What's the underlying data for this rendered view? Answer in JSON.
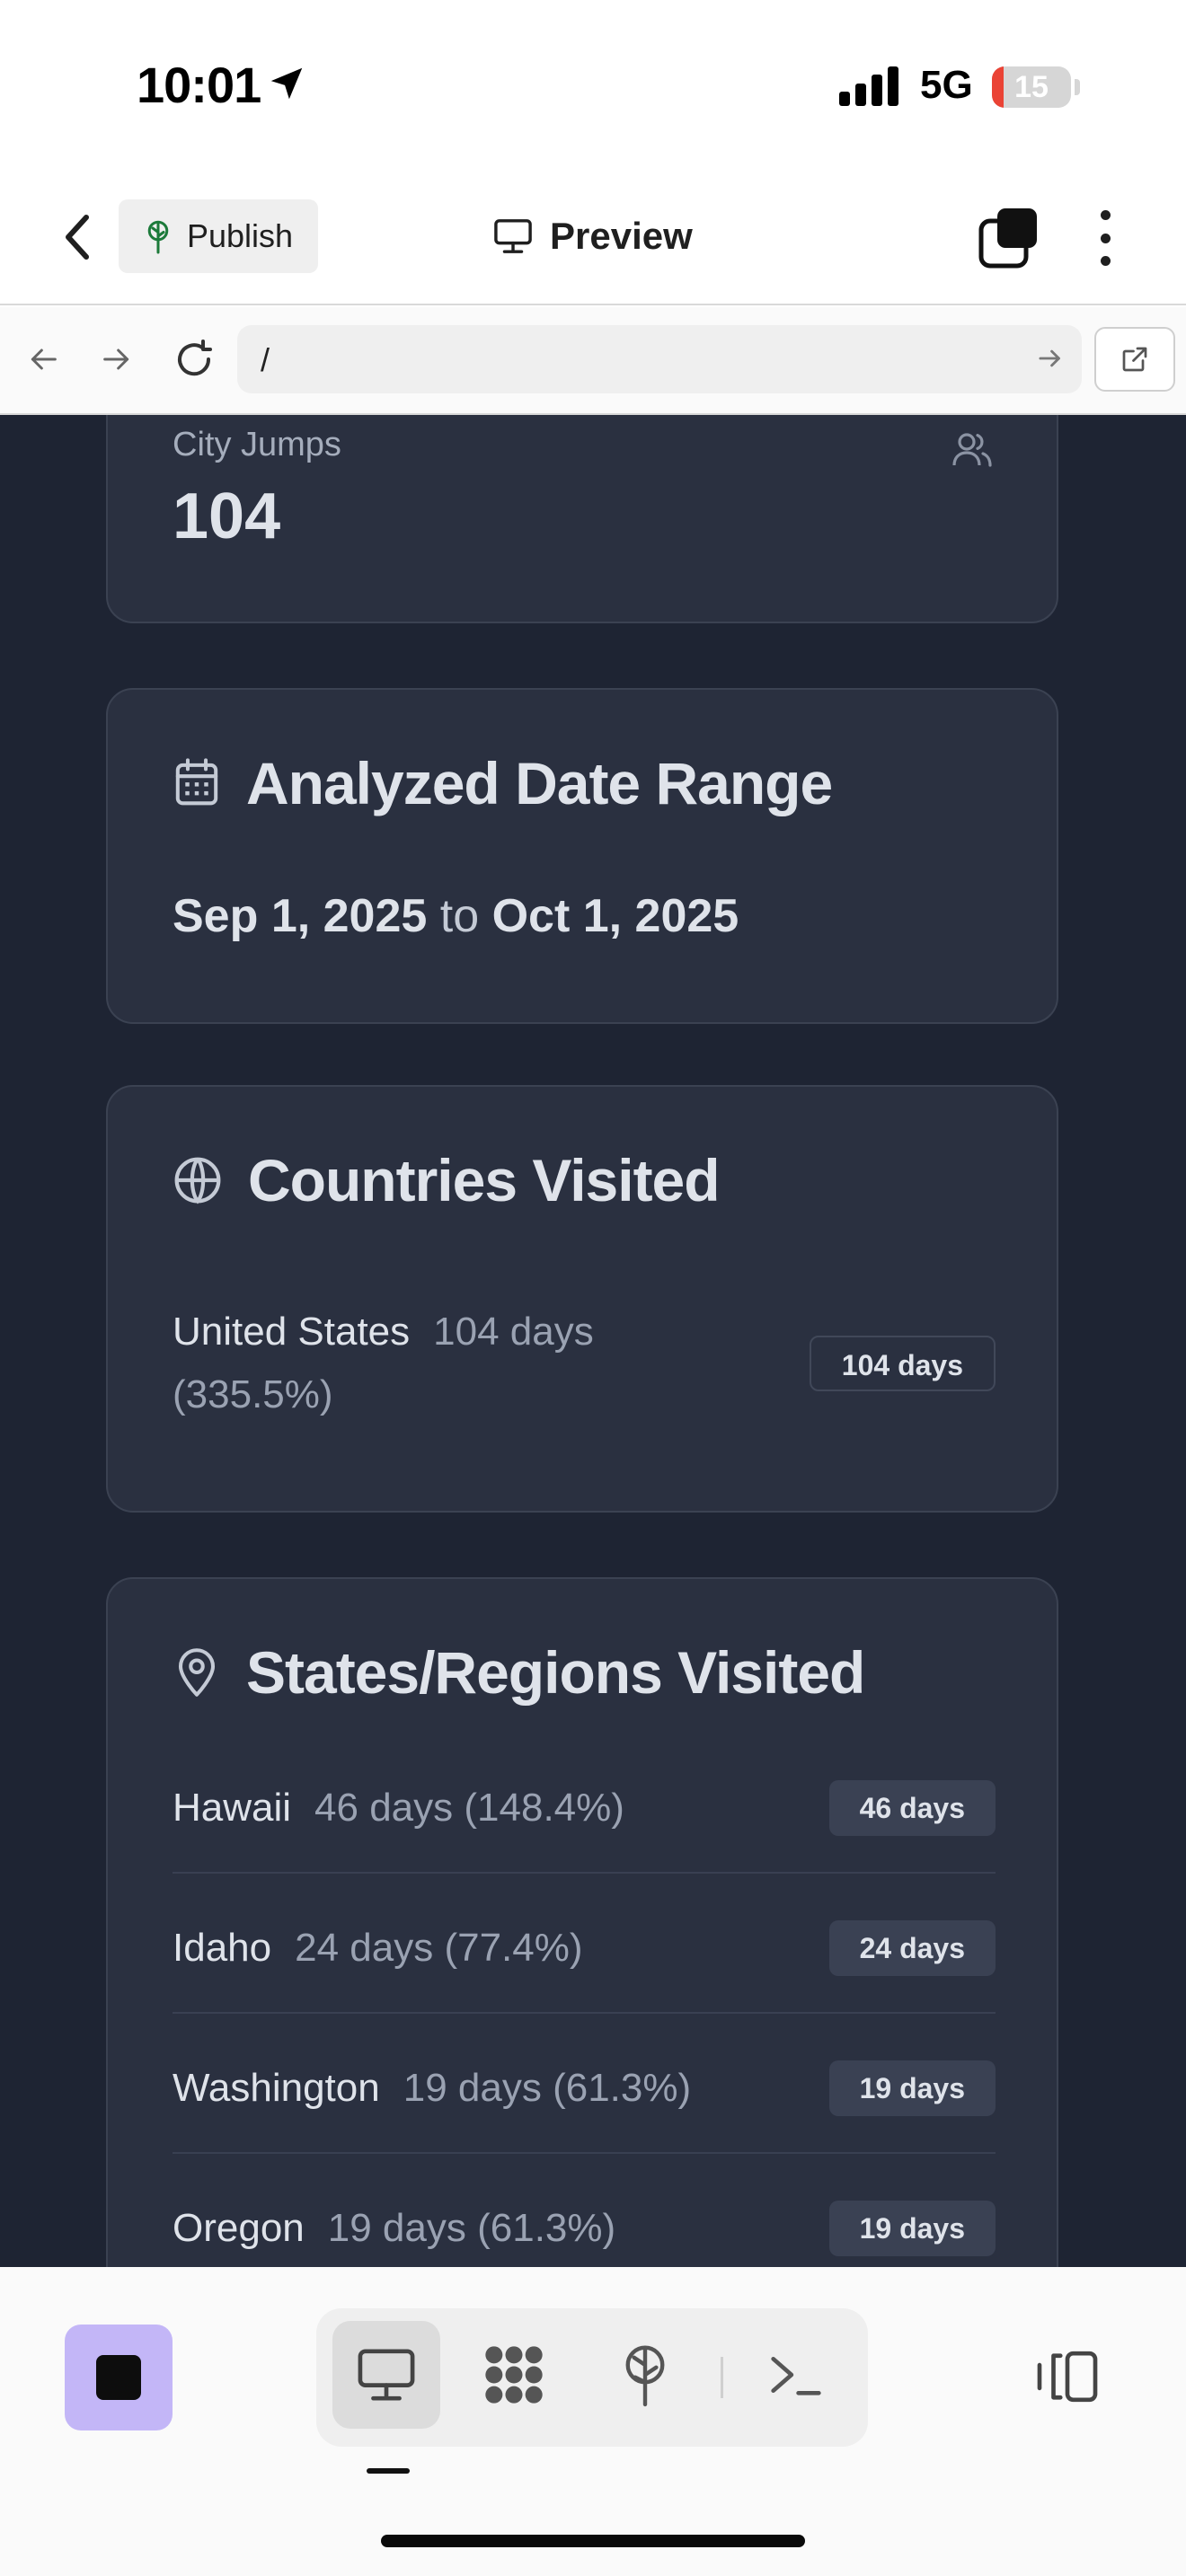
{
  "status_bar": {
    "time": "10:01",
    "network": "5G",
    "battery": "15",
    "battery_level_percent": 15
  },
  "header": {
    "publish_label": "Publish",
    "preview_label": "Preview"
  },
  "browser": {
    "url": "/"
  },
  "stats": {
    "city_jumps_label": "City Jumps",
    "city_jumps_value": "104"
  },
  "date_range": {
    "title": "Analyzed Date Range",
    "start": "Sep 1, 2025",
    "connector": "to",
    "end": "Oct 1, 2025"
  },
  "countries": {
    "title": "Countries Visited",
    "items": [
      {
        "name": "United States",
        "detail_days": "104 days",
        "detail_pct": "(335.5%)",
        "badge": "104 days"
      }
    ]
  },
  "states": {
    "title": "States/Regions Visited",
    "items": [
      {
        "name": "Hawaii",
        "detail": "46 days (148.4%)",
        "badge": "46 days"
      },
      {
        "name": "Idaho",
        "detail": "24 days (77.4%)",
        "badge": "24 days"
      },
      {
        "name": "Washington",
        "detail": "19 days (61.3%)",
        "badge": "19 days"
      },
      {
        "name": "Oregon",
        "detail": "19 days (61.3%)",
        "badge": "19 days"
      }
    ]
  },
  "icons": {
    "status": [
      "location-arrow-icon",
      "signal-icon"
    ],
    "header": [
      "chevron-left-icon",
      "tree-icon",
      "monitor-icon",
      "stack-icon",
      "more-vertical-icon"
    ],
    "browser": [
      "arrow-left-icon",
      "arrow-right-icon",
      "reload-icon",
      "external-link-icon"
    ],
    "cards": [
      "users-icon",
      "calendar-icon",
      "globe-icon",
      "map-pin-icon"
    ],
    "toolbar": [
      "stop-icon",
      "monitor-icon",
      "grid-icon",
      "tree-icon",
      "terminal-icon",
      "panel-icon"
    ]
  },
  "colors": {
    "content_bg": "#1e2433",
    "card_bg": "#2a3040",
    "stop_button": "#c3b6f7",
    "battery_low": "#ea4335"
  }
}
